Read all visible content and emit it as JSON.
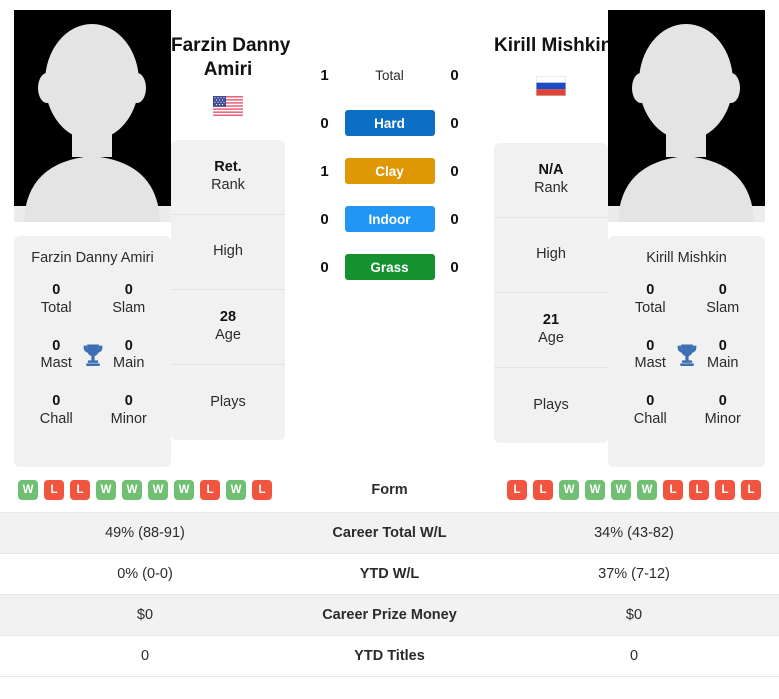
{
  "players": {
    "left": {
      "name": "Farzin Danny Amiri",
      "display_name_line1": "Farzin Danny",
      "display_name_line2": "Amiri",
      "flag": "usa-flag",
      "card_name": "Farzin Danny Amiri",
      "titles": {
        "total_value": "0",
        "total_label": "Total",
        "slam_value": "0",
        "slam_label": "Slam",
        "mast_value": "0",
        "mast_label": "Mast",
        "main_value": "0",
        "main_label": "Main",
        "chall_value": "0",
        "chall_label": "Chall",
        "minor_value": "0",
        "minor_label": "Minor"
      },
      "info": {
        "rank_value": "Ret.",
        "rank_label": "Rank",
        "high_value": "",
        "high_label": "High",
        "age_value": "28",
        "age_label": "Age",
        "plays_value": "",
        "plays_label": "Plays"
      }
    },
    "right": {
      "name": "Kirill Mishkin",
      "display_name_line1": "Kirill Mishkin",
      "display_name_line2": "",
      "flag": "russia-flag",
      "card_name": "Kirill Mishkin",
      "titles": {
        "total_value": "0",
        "total_label": "Total",
        "slam_value": "0",
        "slam_label": "Slam",
        "mast_value": "0",
        "mast_label": "Mast",
        "main_value": "0",
        "main_label": "Main",
        "chall_value": "0",
        "chall_label": "Chall",
        "minor_value": "0",
        "minor_label": "Minor"
      },
      "info": {
        "rank_value": "N/A",
        "rank_label": "Rank",
        "high_value": "",
        "high_label": "High",
        "age_value": "21",
        "age_label": "Age",
        "plays_value": "",
        "plays_label": "Plays"
      }
    }
  },
  "h2h": {
    "rows": [
      {
        "label": "Total",
        "left": "1",
        "right": "0",
        "color": "",
        "pill": false
      },
      {
        "label": "Hard",
        "left": "0",
        "right": "0",
        "color": "#0d6fc4",
        "pill": true
      },
      {
        "label": "Clay",
        "left": "1",
        "right": "0",
        "color": "#e09706",
        "pill": true
      },
      {
        "label": "Indoor",
        "left": "0",
        "right": "0",
        "color": "#2196f3",
        "pill": true
      },
      {
        "label": "Grass",
        "left": "0",
        "right": "0",
        "color": "#13922f",
        "pill": true
      }
    ]
  },
  "stats": {
    "form": {
      "label": "Form",
      "left": [
        "W",
        "L",
        "L",
        "W",
        "W",
        "W",
        "W",
        "L",
        "W",
        "L"
      ],
      "right": [
        "L",
        "L",
        "W",
        "W",
        "W",
        "W",
        "L",
        "L",
        "L",
        "L"
      ]
    },
    "rows": [
      {
        "label": "Career Total W/L",
        "left": "49% (88-91)",
        "right": "34% (43-82)"
      },
      {
        "label": "YTD W/L",
        "left": "0% (0-0)",
        "right": "37% (7-12)"
      },
      {
        "label": "Career Prize Money",
        "left": "$0",
        "right": "$0"
      },
      {
        "label": "YTD Titles",
        "left": "0",
        "right": "0"
      }
    ]
  },
  "colors": {
    "win": "#70bf73",
    "loss": "#f1553f",
    "card_bg": "#f1f1f1",
    "trophy": "#3d6fb4"
  }
}
